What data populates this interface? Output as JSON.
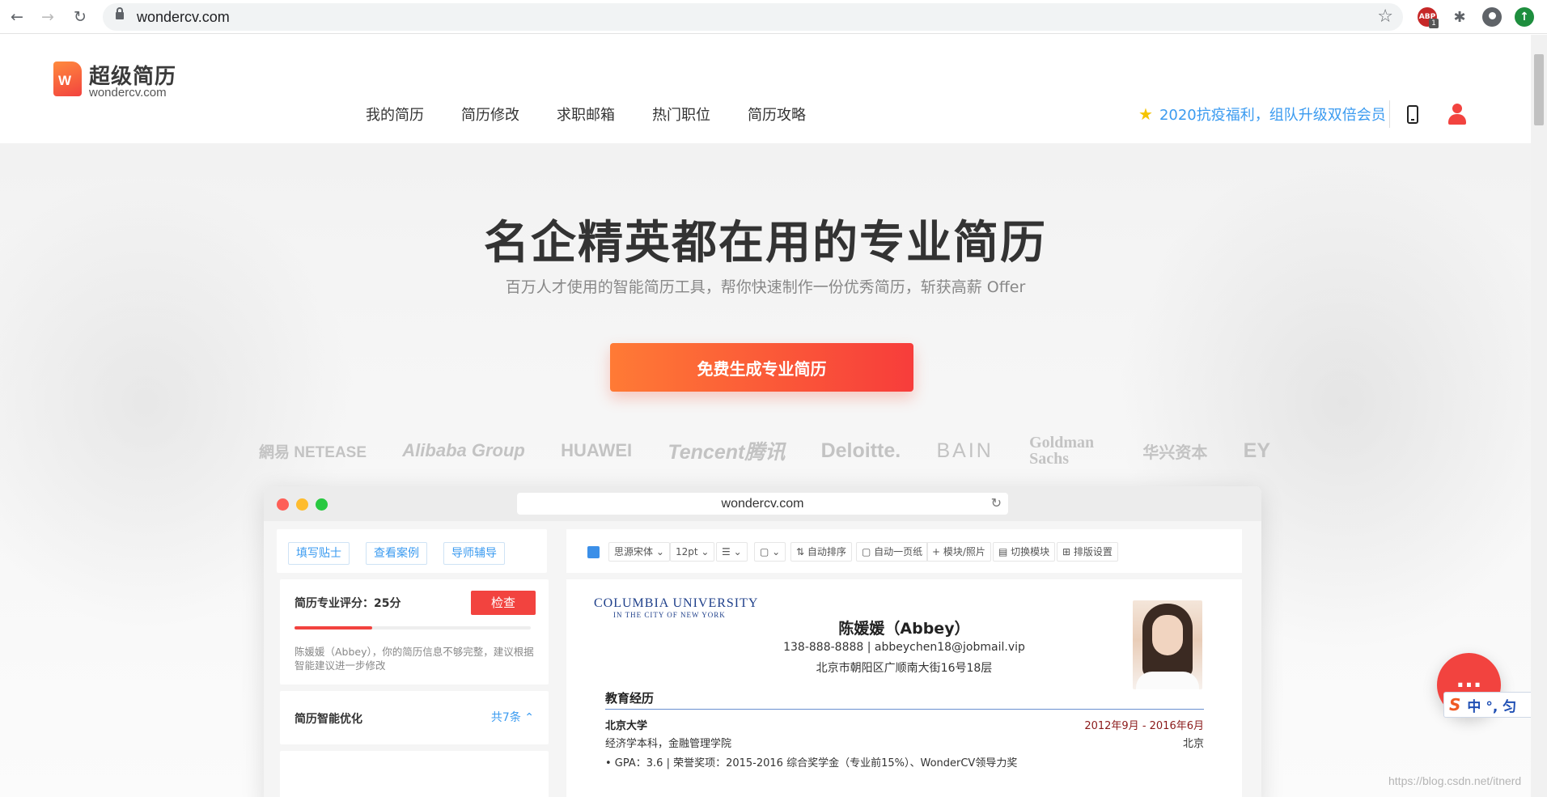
{
  "browser": {
    "url": "wondercv.com",
    "back_icon": "←",
    "forward_icon": "→",
    "reload_icon": "↻",
    "star_icon": "☆",
    "extension_badge": "1"
  },
  "header": {
    "logo_mark": "W",
    "logo_title": "超级简历",
    "logo_subtitle": "wondercv.com",
    "nav": [
      "我的简历",
      "简历修改",
      "求职邮箱",
      "热门职位",
      "简历攻略"
    ],
    "promo_text": "2020抗疫福利，组队升级双倍会员",
    "promo_icon": "★"
  },
  "hero": {
    "title": "名企精英都在用的专业简历",
    "subtitle": "百万人才使用的智能简历工具，帮你快速制作一份优秀简历，斩获高薪 Offer",
    "cta_label": "免费生成专业简历",
    "brands": [
      "網易 NETEASE",
      "Alibaba Group",
      "HUAWEI",
      "Tencent腾讯",
      "Deloitte.",
      "BAIN",
      "Goldman Sachs",
      "华兴资本",
      "EY"
    ]
  },
  "mock": {
    "url": "wondercv.com",
    "reload_icon": "↻",
    "chips": [
      "填写贴士",
      "查看案例",
      "导师辅导"
    ],
    "score_title": "简历专业评分：25分",
    "check_label": "检查",
    "score_progress": 0.33,
    "score_desc": "陈媛媛（Abbey），你的简历信息不够完整，建议根据智能建议进一步修改",
    "optimize_title": "简历智能优化",
    "optimize_count": "共7条 ⌃",
    "toolbar": [
      "思源宋体 ⌄",
      "12pt ⌄",
      "☰ ⌄",
      "▢ ⌄",
      "⇅ 自动排序",
      "▢ 自动一页纸",
      "+ 模块/照片",
      "▤ 切换模块",
      "⊞ 排版设置"
    ],
    "resume": {
      "school_logo_1": "COLUMBIA UNIVERSITY",
      "school_logo_2": "IN THE CITY OF NEW YORK",
      "name": "陈媛媛（Abbey）",
      "contact": "138-888-8888 | abbeychen18@jobmail.vip",
      "address": "北京市朝阳区广顺南大街16号18层",
      "section_title": "教育经历",
      "school": "北京大学",
      "date": "2012年9月 - 2016年6月",
      "major": "经济学本科，金融管理学院",
      "city": "北京",
      "gpa": "•   GPA：3.6 | 荣誉奖项：2015-2016 综合奖学金（专业前15%）、WonderCV领导力奖"
    }
  },
  "floating": {
    "chat_icon": "···",
    "ime_text": "中 °, 匀",
    "ime_logo": "S"
  },
  "watermark": "https://blog.csdn.net/itnerd"
}
